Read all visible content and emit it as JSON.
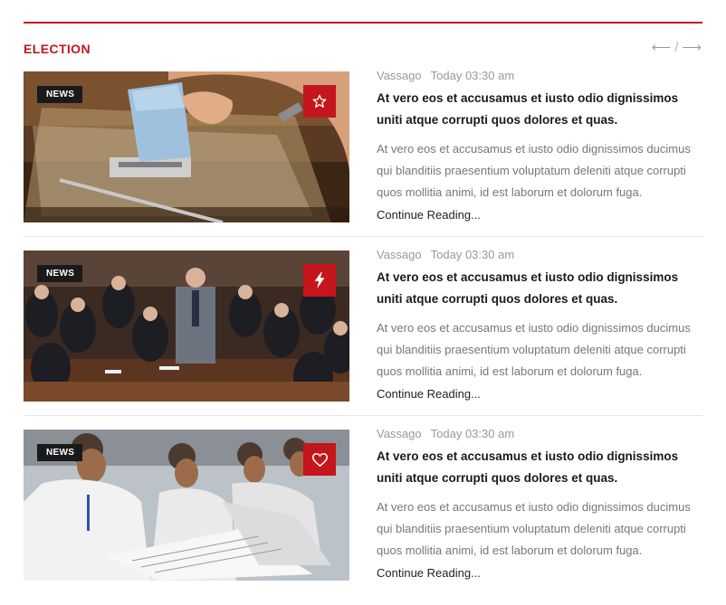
{
  "section": {
    "title": "ELECTION",
    "prev_arrow": "⟵",
    "separator": "/",
    "next_arrow": "⟶"
  },
  "colors": {
    "accent": "#c4161c",
    "badge_bg": "#1a1a1a"
  },
  "posts": [
    {
      "category": "NEWS",
      "format_icon": "star-icon",
      "author": "Vassago",
      "date": "Today 03:30 am",
      "title": "At vero eos et accusamus et iusto odio dignissimos uniti atque corrupti quos dolores et quas.",
      "excerpt": "At vero eos et accusamus et iusto odio dignissimos ducimus qui blanditiis praesentium voluptatum deleniti atque corrupti quos mollitia animi, id est laborum et dolorum fuga.",
      "read_more": "Continue Reading..."
    },
    {
      "category": "NEWS",
      "format_icon": "lightning-icon",
      "author": "Vassago",
      "date": "Today 03:30 am",
      "title": "At vero eos et accusamus et iusto odio dignissimos uniti atque corrupti quos dolores et quas.",
      "excerpt": "At vero eos et accusamus et iusto odio dignissimos ducimus qui blanditiis praesentium voluptatum deleniti atque corrupti quos mollitia animi, id est laborum et dolorum fuga.",
      "read_more": "Continue Reading..."
    },
    {
      "category": "NEWS",
      "format_icon": "heart-icon",
      "author": "Vassago",
      "date": "Today 03:30 am",
      "title": "At vero eos et accusamus et iusto odio dignissimos uniti atque corrupti quos dolores et quas.",
      "excerpt": "At vero eos et accusamus et iusto odio dignissimos ducimus qui blanditiis praesentium voluptatum deleniti atque corrupti quos mollitia animi, id est laborum et dolorum fuga.",
      "read_more": "Continue Reading..."
    }
  ]
}
